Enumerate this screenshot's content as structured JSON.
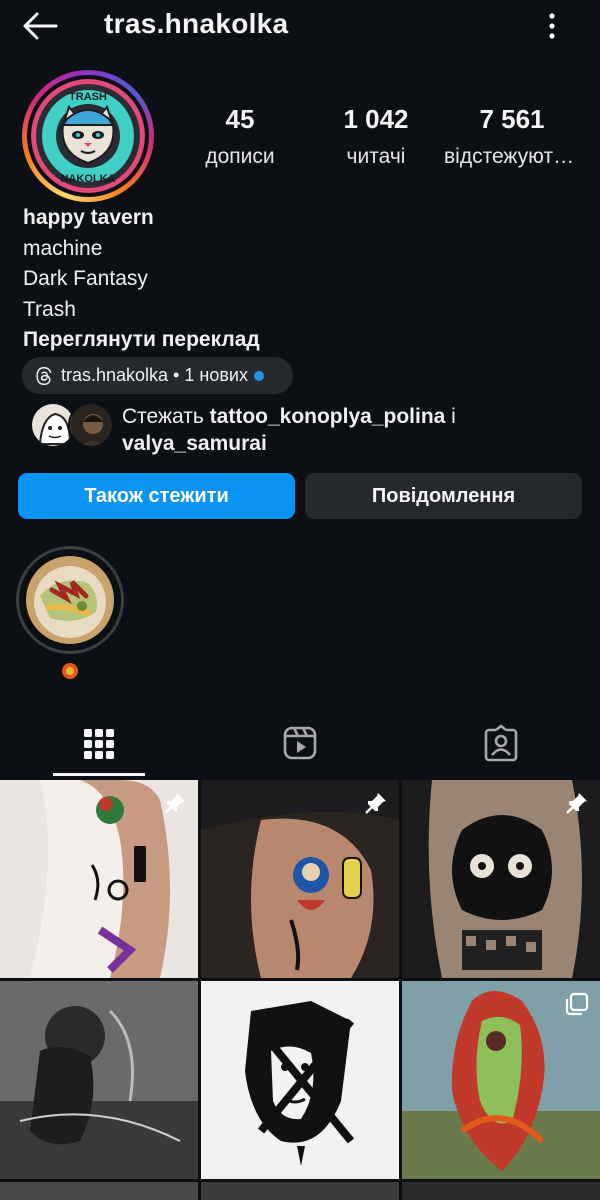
{
  "header": {
    "username": "tras.hnakolka"
  },
  "avatar": {
    "logo_text_top": "TRASH",
    "logo_text_bottom": "NAKOLKA"
  },
  "stats": [
    {
      "value": "45",
      "label": "дописи"
    },
    {
      "value": "1 042",
      "label": "читачі"
    },
    {
      "value": "7 561",
      "label": "відстежуються"
    }
  ],
  "bio": {
    "name": "happy tavern",
    "lines": [
      "machine",
      "Dark Fantasy",
      "Trash"
    ],
    "translate": "Переглянути переклад"
  },
  "threads": {
    "label": "tras.hnakolka • 1 нових"
  },
  "followed_by": {
    "prefix": "Стежать ",
    "user1": "tattoo_konoplya_polina",
    "joiner": " і",
    "user2": "valya_samurai"
  },
  "buttons": {
    "follow": "Також стежити",
    "message": "Повідомлення"
  },
  "colors": {
    "background": "#0c1014",
    "follow_button": "#0a95f6",
    "secondary_button": "#25292e",
    "unread_dot": "#1c96f0"
  },
  "tabs": [
    "grid-icon",
    "reels-icon",
    "tagged-icon"
  ],
  "grid": {
    "posts": [
      {
        "pinned": true
      },
      {
        "pinned": true
      },
      {
        "pinned": true
      },
      {
        "pinned": false
      },
      {
        "pinned": false
      },
      {
        "pinned": false,
        "carousel": true
      }
    ]
  }
}
